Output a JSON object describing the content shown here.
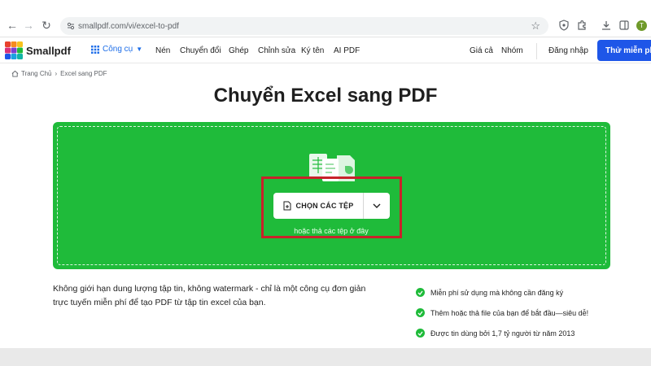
{
  "browser": {
    "url": "smallpdf.com/vi/excel-to-pdf",
    "profile_initial": "T"
  },
  "header": {
    "logo_text": "Smallpdf",
    "tools_label": "Công cụ",
    "nav": [
      "Nén",
      "Chuyển đổi",
      "Ghép",
      "Chỉnh sửa",
      "Ký tên",
      "AI PDF"
    ],
    "pricing": "Giá cả",
    "teams": "Nhóm",
    "login": "Đăng nhập",
    "cta": "Thử miễn phí",
    "cta_color": "#1e56e8"
  },
  "breadcrumb": {
    "home": "Trang Chủ",
    "current": "Excel sang PDF"
  },
  "main": {
    "title": "Chuyển Excel sang PDF",
    "choose_label": "CHỌN CÁC TỆP",
    "drop_hint": "hoặc thả các tệp ở đây",
    "accent": "#1fbb3a",
    "highlight_color": "#c8222a"
  },
  "description": "Không giới hạn dung lượng tập tin, không watermark - chỉ là một công cụ đơn giản trực tuyến miễn phí để tạo PDF từ tập tin excel của bạn.",
  "features": [
    "Miễn phí sử dụng mà không cần đăng ký",
    "Thêm hoặc thả file của bạn để bắt đầu—siêu dễ!",
    "Được tin dùng bởi 1,7 tỷ người từ năm 2013"
  ]
}
